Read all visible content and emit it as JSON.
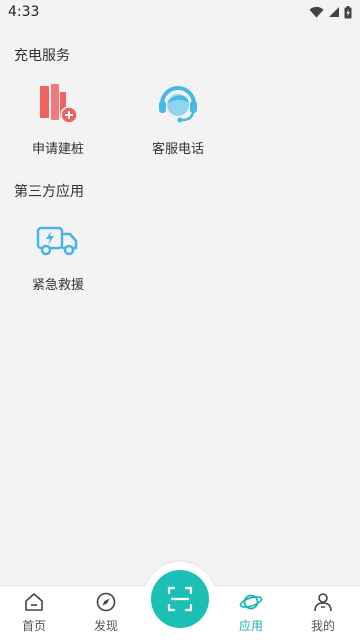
{
  "status_bar": {
    "time": "4:33"
  },
  "sections": {
    "charging": {
      "title": "充电服务",
      "items": [
        {
          "label": "申请建桩",
          "icon": "build-pile-icon"
        },
        {
          "label": "客服电话",
          "icon": "customer-service-icon"
        }
      ]
    },
    "third_party": {
      "title": "第三方应用",
      "items": [
        {
          "label": "紧急救援",
          "icon": "rescue-truck-icon"
        }
      ]
    }
  },
  "bottom_nav": {
    "items": [
      {
        "label": "首页",
        "icon": "home-icon"
      },
      {
        "label": "发现",
        "icon": "compass-icon"
      },
      {
        "label": "应用",
        "icon": "planet-icon",
        "active": true
      },
      {
        "label": "我的",
        "icon": "user-icon"
      }
    ],
    "scan_icon": "scan-icon"
  },
  "colors": {
    "accent": "#1bbfb4",
    "active_label": "#19b4b0",
    "pile_red": "#f06262",
    "service_blue": "#47b9e8"
  }
}
